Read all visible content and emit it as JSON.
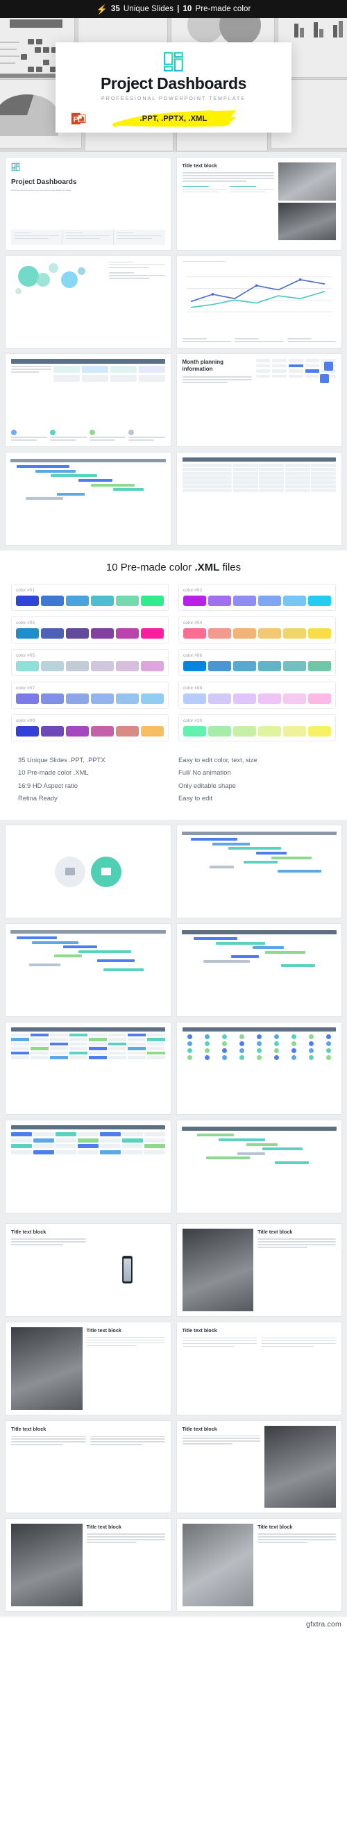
{
  "banner": {
    "icon": "lightning-bolt-icon",
    "count_slides": "35",
    "slides_label": "Unique Slides",
    "separator": "|",
    "count_colors": "10",
    "colors_label": "Pre-made color"
  },
  "hero": {
    "logo_icon": "dashboard-grid-icon",
    "title": "Project Dashboards",
    "subtitle": "PROFESSIONAL POWERPOINT TEMPLATE",
    "formats_badge": ".PPT, .PPTX, .XML",
    "badge_highlight_color": "#fff200",
    "app_icon": "powerpoint-icon"
  },
  "preview_grid_1": {
    "slides": [
      {
        "name": "cover-slide",
        "title": "Project Dashboards",
        "subtitle": "Professional PowerPoint, Keynote and Google Slides Template",
        "kind": "cover"
      },
      {
        "name": "title-text-photo-slide",
        "title": "Title text block",
        "subtitle": "Lorem ipsum dolor sit amet, consectetur adipiscing elit, sed do eiusmod tempor incididunt ut labore et dolore magna aliqua.",
        "kind": "photo-text"
      },
      {
        "name": "bubble-chart-slide",
        "title": "",
        "kind": "bubbles"
      },
      {
        "name": "line-chart-slide",
        "title": "",
        "kind": "line"
      },
      {
        "name": "table-color-slide",
        "title": "",
        "kind": "table"
      },
      {
        "name": "month-planning-slide",
        "title": "Month planning information",
        "subtitle": "Lorem ipsum dolor sit amet, consectetur adipiscing elit, sed do eiusmod tempor incididunt ut labore et dolore magna aliqua.",
        "kind": "calendar"
      },
      {
        "name": "gantt-chart-slide",
        "title": "",
        "kind": "gantt"
      },
      {
        "name": "data-table-slide",
        "title": "",
        "kind": "datatable"
      }
    ]
  },
  "colors_section": {
    "heading_prefix": "10 Pre-made color ",
    "heading_bold": ".XML",
    "heading_suffix": " files",
    "palettes": [
      {
        "label": "color #01",
        "swatches": [
          "#2f45d8",
          "#3f78d0",
          "#4aa3dc",
          "#4fbcd0",
          "#74d9ac",
          "#31eb8f"
        ]
      },
      {
        "label": "color #02",
        "swatches": [
          "#b822e8",
          "#a070ee",
          "#8f8cf2",
          "#7fa6f3",
          "#77c5f4",
          "#23cdf0"
        ]
      },
      {
        "label": "color #03",
        "swatches": [
          "#1f8fcc",
          "#4e62b5",
          "#634a9d",
          "#8340a0",
          "#ba44ab",
          "#fa1f9e"
        ]
      },
      {
        "label": "color #04",
        "swatches": [
          "#fb6e92",
          "#f29b8c",
          "#f2b378",
          "#f3c873",
          "#f2d46d",
          "#f9dc4a"
        ]
      },
      {
        "label": "color #05",
        "swatches": [
          "#8fe0d8",
          "#b9d2dc",
          "#c4cbd8",
          "#cfc7dd",
          "#d7bede",
          "#dfa5de"
        ]
      },
      {
        "label": "color #06",
        "swatches": [
          "#0585e0",
          "#4b95d3",
          "#58a8cf",
          "#63b4c9",
          "#74bfbf",
          "#70c6a7"
        ]
      },
      {
        "label": "color #07",
        "swatches": [
          "#7b7ae6",
          "#8090e4",
          "#8da5e9",
          "#93b4ee",
          "#96c2ef",
          "#8fcdf2"
        ]
      },
      {
        "label": "color #08",
        "swatches": [
          "#b7ccfb",
          "#d2c8fa",
          "#dfc5fa",
          "#eec4f7",
          "#f6c9f0",
          "#ffb9e6"
        ]
      },
      {
        "label": "color #09",
        "swatches": [
          "#3240d8",
          "#6e49b8",
          "#a447c1",
          "#c561a8",
          "#d98a85",
          "#f8bc63"
        ]
      },
      {
        "label": "color #10",
        "swatches": [
          "#62f2ae",
          "#a4edab",
          "#c7f0a5",
          "#e0f39f",
          "#eff29b",
          "#f6f266"
        ]
      }
    ]
  },
  "features": {
    "left": [
      "35 Unique Slides .PPT, .PPTX",
      "10 Pre-made color .XML",
      "16:9 HD Aspect ratio",
      "Retina Ready"
    ],
    "right": [
      "Easy to edit color, text, size",
      "Full/ No animation",
      "Only editable shape",
      "Easy to edit"
    ]
  },
  "preview_grid_2": {
    "slides": [
      {
        "name": "two-circle-diagram-slide",
        "kind": "circles"
      },
      {
        "name": "gantt-timeline-slide-a",
        "kind": "gantt"
      },
      {
        "name": "gantt-timeline-slide-b",
        "kind": "gantt"
      },
      {
        "name": "gantt-timeline-slide-c",
        "kind": "gantt"
      },
      {
        "name": "matrix-grid-slide",
        "kind": "matrix"
      },
      {
        "name": "dot-matrix-slide",
        "kind": "dots"
      },
      {
        "name": "roadmap-slide",
        "kind": "roadmap"
      },
      {
        "name": "gantt-timeline-slide-d",
        "kind": "gantt"
      }
    ]
  },
  "preview_grid_3": {
    "slides": [
      {
        "name": "phone-mockup-slide",
        "title": "Title text block",
        "kind": "phone"
      },
      {
        "name": "device-photo-slide",
        "title": "Title text block",
        "kind": "photo-right"
      },
      {
        "name": "laptop-photo-slide",
        "title": "Title text block",
        "kind": "photo-left"
      },
      {
        "name": "text-only-slide",
        "title": "Title text block",
        "kind": "text"
      },
      {
        "name": "team-photo-slide",
        "title": "Title text block",
        "kind": "text"
      },
      {
        "name": "businessman-photo-slide",
        "title": "Title text block",
        "kind": "photo-right"
      },
      {
        "name": "portrait-photo-slide",
        "title": "Title text block",
        "kind": "photo-left"
      },
      {
        "name": "architecture-photo-slide",
        "title": "Title text block",
        "kind": "photo-left-dark"
      }
    ]
  },
  "footer": {
    "watermark": "gfxtra.com"
  }
}
